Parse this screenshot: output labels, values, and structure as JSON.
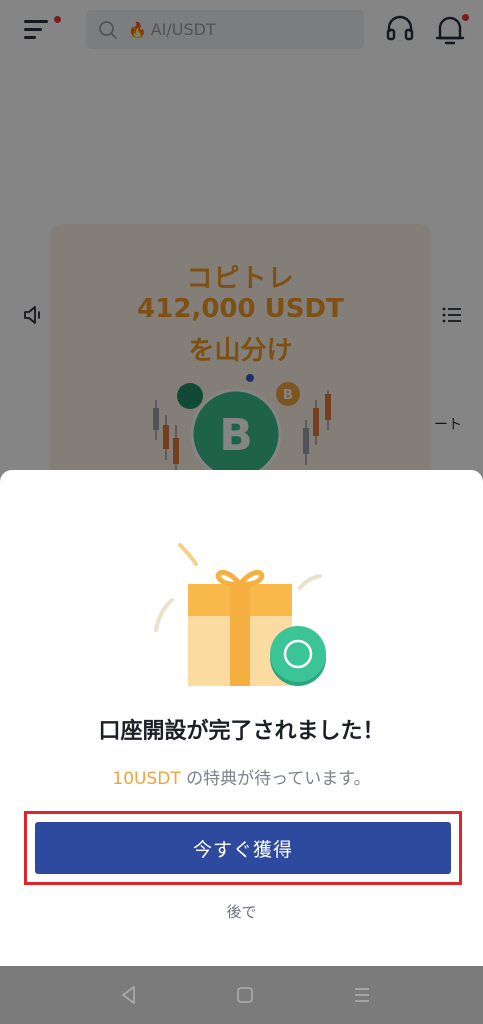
{
  "header": {
    "search_hint": "AI/USDT",
    "fire_icon": "🔥",
    "notification_color": "#e53935"
  },
  "banner": {
    "line1": "コピトレ",
    "line2": "412,000 USDT",
    "line3": "を山分け",
    "accent_color": "#f19a27"
  },
  "background": {
    "side_text": "ート"
  },
  "dialog": {
    "title": "口座開設が完了されました！",
    "subtitle_amount": "10USDT",
    "subtitle_rest": " の特典が待っています。",
    "cta_label": "今すぐ獲得",
    "later_label": "後で",
    "cta_color": "#2d4a9e",
    "highlight_color": "#e0242b"
  },
  "navbar": {
    "icons": [
      "back-icon",
      "home-icon",
      "recent-apps-icon"
    ]
  }
}
